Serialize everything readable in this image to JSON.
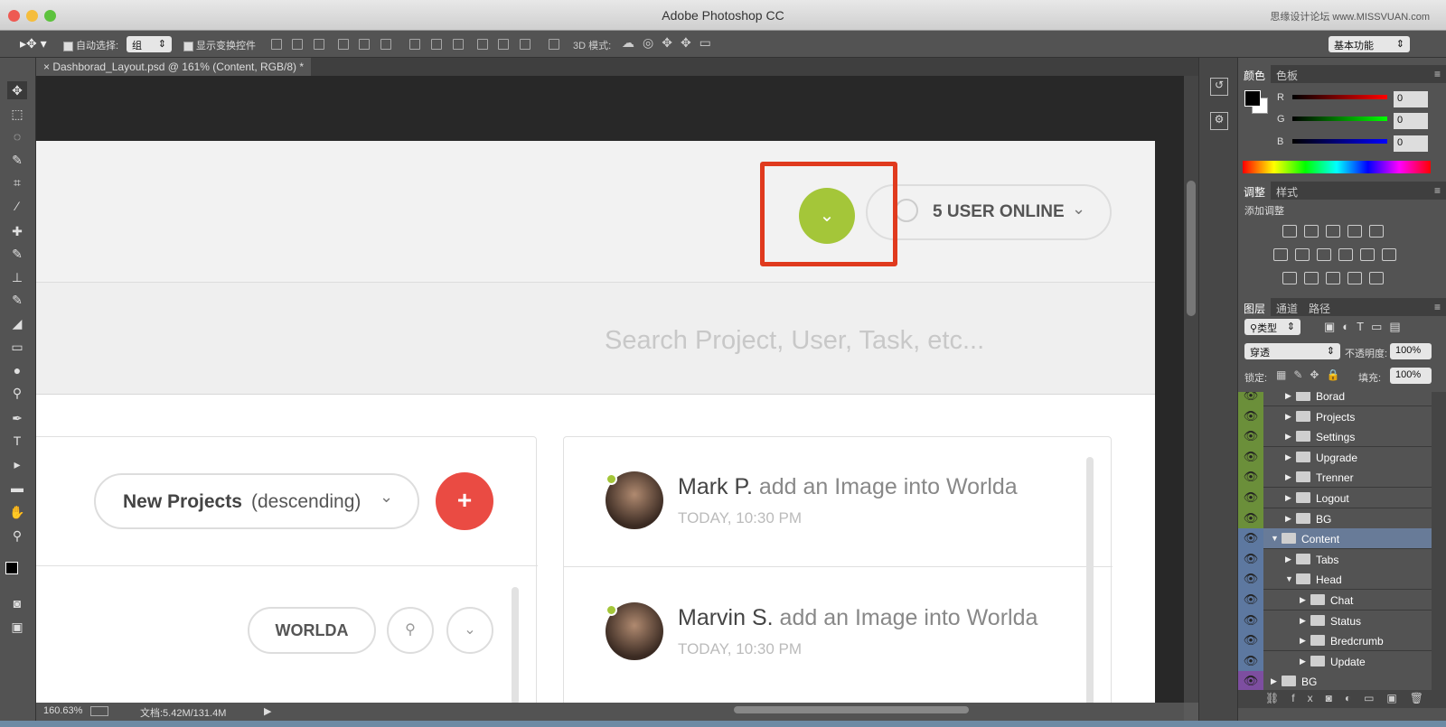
{
  "window": {
    "title": "Adobe Photoshop CC",
    "watermark": "思缘设计论坛 www.MISSVUAN.com"
  },
  "options_bar": {
    "auto_select_label": "自动选择:",
    "auto_select_value": "组",
    "show_transform_label": "显示变换控件",
    "mode_3d_label": "3D 模式:",
    "workspace": "基本功能"
  },
  "document": {
    "tab_label": "Dashborad_Layout.psd @ 161% (Content, RGB/8) *",
    "zoom": "160.63%",
    "doc_size": "文档:5.42M/131.4M"
  },
  "mock": {
    "users_online": "5 USER ONLINE",
    "search_placeholder": "Search Project, User, Task, etc...",
    "new_projects_bold": "New Projects",
    "new_projects_rest": "(descending)",
    "add_symbol": "+",
    "tag": "WORLDA",
    "feed": [
      {
        "name": "Mark P.",
        "action": "add an Image into Worlda",
        "time": "TODAY, 10:30 PM"
      },
      {
        "name": "Marvin S.",
        "action": "add an Image into Worlda",
        "time": "TODAY, 10:30 PM"
      }
    ]
  },
  "color_panel": {
    "tabs": [
      "颜色",
      "色板"
    ],
    "channels": [
      {
        "label": "R",
        "value": "0"
      },
      {
        "label": "G",
        "value": "0"
      },
      {
        "label": "B",
        "value": "0"
      }
    ]
  },
  "adjust_panel": {
    "tabs": [
      "调整",
      "样式"
    ],
    "add_label": "添加调整"
  },
  "layers_panel": {
    "tabs": [
      "图层",
      "通道",
      "路径"
    ],
    "filter": "类型",
    "blend_mode": "穿透",
    "opacity_label": "不透明度:",
    "opacity": "100%",
    "lock_label": "锁定:",
    "fill_label": "填充:",
    "fill": "100%",
    "layers": [
      {
        "name": "Borad",
        "indent": 1,
        "expanded": false,
        "color": "#6b8f3a"
      },
      {
        "name": "Projects",
        "indent": 1,
        "expanded": false,
        "color": "#6b8f3a"
      },
      {
        "name": "Settings",
        "indent": 1,
        "expanded": false,
        "color": "#6b8f3a"
      },
      {
        "name": "Upgrade",
        "indent": 1,
        "expanded": false,
        "color": "#6b8f3a"
      },
      {
        "name": "Trenner",
        "indent": 1,
        "expanded": false,
        "color": "#6b8f3a"
      },
      {
        "name": "Logout",
        "indent": 1,
        "expanded": false,
        "color": "#6b8f3a"
      },
      {
        "name": "BG",
        "indent": 1,
        "expanded": false,
        "color": "#6b8f3a"
      },
      {
        "name": "Content",
        "indent": 0,
        "expanded": true,
        "color": "#5d78a0",
        "selected": true
      },
      {
        "name": "Tabs",
        "indent": 1,
        "expanded": false,
        "color": "#5d78a0"
      },
      {
        "name": "Head",
        "indent": 1,
        "expanded": true,
        "color": "#5d78a0"
      },
      {
        "name": "Chat",
        "indent": 2,
        "expanded": false,
        "color": "#5d78a0"
      },
      {
        "name": "Status",
        "indent": 2,
        "expanded": false,
        "color": "#5d78a0"
      },
      {
        "name": "Bredcrumb",
        "indent": 2,
        "expanded": false,
        "color": "#5d78a0"
      },
      {
        "name": "Update",
        "indent": 2,
        "expanded": false,
        "color": "#5d78a0"
      },
      {
        "name": "BG",
        "indent": 0,
        "expanded": false,
        "color": "#7d4ea0"
      }
    ]
  }
}
